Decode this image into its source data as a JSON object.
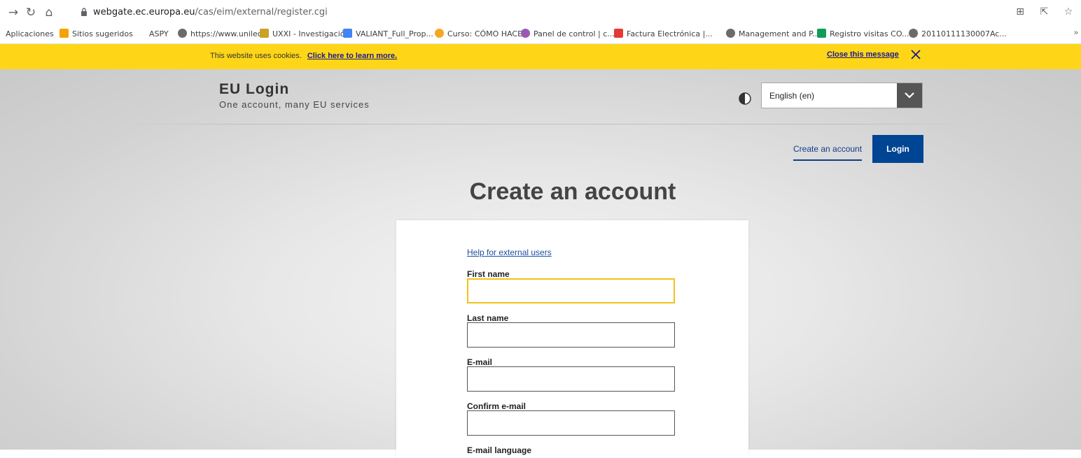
{
  "browser": {
    "url_host": "webgate.ec.europa.eu",
    "url_path": "/cas/eim/external/register.cgi",
    "bookmarks": [
      {
        "label": "Aplicaciones",
        "icon": "apps-grid-icon",
        "color": ""
      },
      {
        "label": "Sitios sugeridos",
        "icon": "bing-icon",
        "color": "#f4a300"
      },
      {
        "label": "ASPY",
        "icon": "",
        "color": ""
      },
      {
        "label": "https://www.unileo...",
        "icon": "globe-icon",
        "color": "#5f6368"
      },
      {
        "label": "UXXI - Investigació...",
        "icon": "uxxi-icon",
        "color": "#c9a227"
      },
      {
        "label": "VALIANT_Full_Prop...",
        "icon": "docs-icon",
        "color": "#4285f4"
      },
      {
        "label": "Curso: CÓMO HACE...",
        "icon": "moodle-icon",
        "color": "#f5a623"
      },
      {
        "label": "Panel de control | c...",
        "icon": "panel-icon",
        "color": "#9b59b6"
      },
      {
        "label": "Factura Electrónica |...",
        "icon": "factura-icon",
        "color": "#e53935"
      },
      {
        "label": "Management and P...",
        "icon": "globe-icon",
        "color": "#5f6368"
      },
      {
        "label": "Registro visitas CO...",
        "icon": "drive-icon",
        "color": "#0f9d58"
      },
      {
        "label": "20110111130007Ac...",
        "icon": "globe-icon",
        "color": "#5f6368"
      }
    ],
    "more": "»"
  },
  "cookie_banner": {
    "text": "This website uses cookies.",
    "link": "Click here to learn more.",
    "close": "Close this message"
  },
  "header": {
    "title": "EU Login",
    "subtitle": "One account, many EU services",
    "language": "English (en)"
  },
  "nav": {
    "create_account": "Create an account",
    "login": "Login"
  },
  "main": {
    "title": "Create an account",
    "help_link": "Help for external users",
    "fields": [
      {
        "label": "First name",
        "value": ""
      },
      {
        "label": "Last name",
        "value": ""
      },
      {
        "label": "E-mail",
        "value": ""
      },
      {
        "label": "Confirm e-mail",
        "value": ""
      },
      {
        "label": "E-mail language"
      }
    ]
  },
  "colors": {
    "banner": "#ffd617",
    "primary": "#004494",
    "focus": "#f2c21a"
  }
}
